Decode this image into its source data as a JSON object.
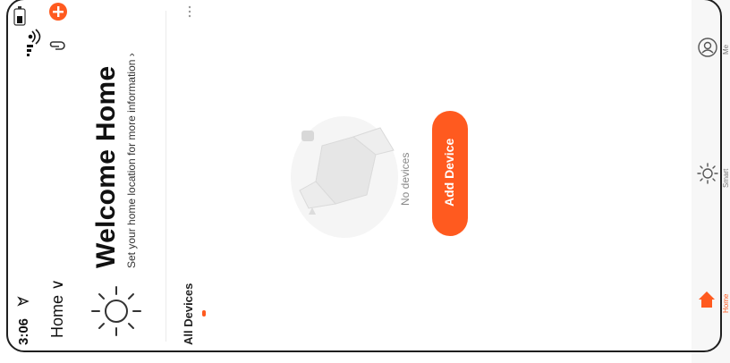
{
  "status_bar": {
    "time": "3:06"
  },
  "header": {
    "home_selector": "Home",
    "title": "Welcome Home",
    "subtitle": "Set your home location for more information"
  },
  "tabs": {
    "active": "All Devices"
  },
  "empty_state": {
    "message": "No devices",
    "add_button": "Add Device"
  },
  "bottom_nav": {
    "items": [
      {
        "label": "Home",
        "icon": "home-icon",
        "active": true
      },
      {
        "label": "Smart",
        "icon": "sun-icon",
        "active": false
      },
      {
        "label": "Me",
        "icon": "profile-icon",
        "active": false
      }
    ]
  },
  "colors": {
    "accent": "#ff5a1f"
  }
}
